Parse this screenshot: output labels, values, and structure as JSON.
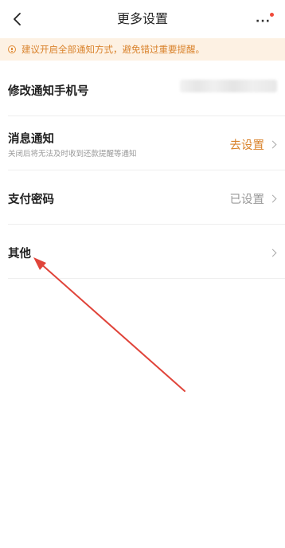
{
  "nav": {
    "title": "更多设置",
    "back_icon": "chevron-left-icon",
    "more_icon": "more-horizontal-icon",
    "more_label": "···"
  },
  "notice": {
    "icon": "info-circle-icon",
    "text": "建议开启全部通知方式，避免错过重要提醒。"
  },
  "settings": [
    {
      "title": "修改通知手机号",
      "subtitle": "",
      "value": "",
      "value_blurred": true
    },
    {
      "title": "消息通知",
      "subtitle": "关闭后将无法及时收到还款提醒等通知",
      "value": "去设置"
    },
    {
      "title": "支付密码",
      "subtitle": "",
      "value": "已设置"
    },
    {
      "title": "其他",
      "subtitle": "",
      "value": ""
    }
  ],
  "colors": {
    "accent": "#e08a34",
    "notice_bg": "#fdf1e3",
    "highlight_value": "#d9822b",
    "muted_value": "#999999",
    "annotation_arrow": "#e0443a"
  }
}
